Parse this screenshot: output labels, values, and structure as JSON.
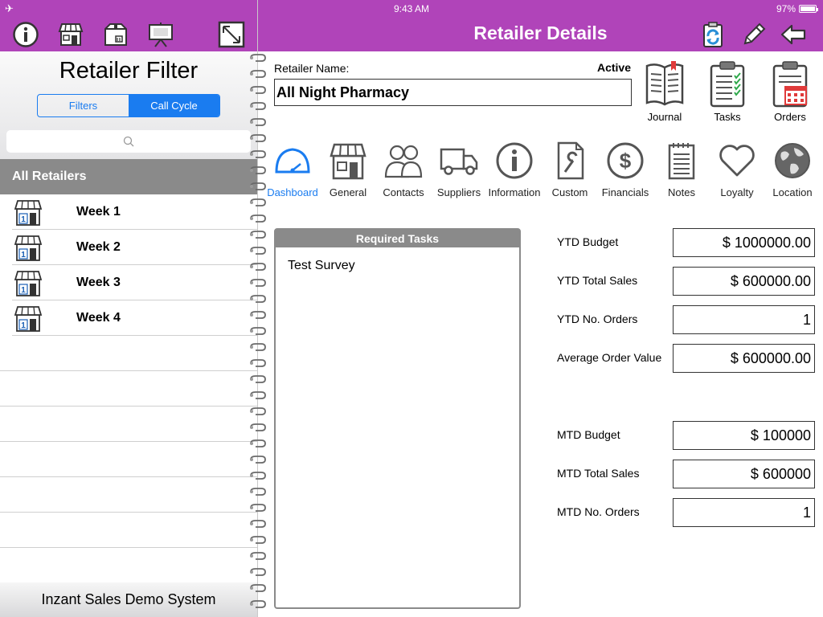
{
  "status": {
    "time": "9:43 AM",
    "battery": "97%",
    "airplane": "✈"
  },
  "toolbar_left": [
    {
      "icon": "info-icon"
    },
    {
      "icon": "store-icon"
    },
    {
      "icon": "package-icon"
    },
    {
      "icon": "presentation-icon"
    },
    {
      "icon": "resize-icon"
    }
  ],
  "header": {
    "title": "Retailer Details"
  },
  "toolbar_right": [
    {
      "icon": "sync-clipboard-icon"
    },
    {
      "icon": "pencil-icon"
    },
    {
      "icon": "back-arrow-icon"
    }
  ],
  "filter": {
    "title": "Retailer Filter",
    "segments": [
      "Filters",
      "Call Cycle"
    ],
    "selected": "Call Cycle",
    "search_placeholder": ""
  },
  "list": {
    "header": "All Retailers",
    "items": [
      "Week 1",
      "Week 2",
      "Week 3",
      "Week 4"
    ]
  },
  "footer": {
    "text": "Inzant Sales Demo System"
  },
  "retailer": {
    "name_label": "Retailer Name:",
    "status": "Active",
    "name": "All Night Pharmacy"
  },
  "quick_actions": [
    "Journal",
    "Tasks",
    "Orders"
  ],
  "nav": [
    "Dashboard",
    "General",
    "Contacts",
    "Suppliers",
    "Information",
    "Custom",
    "Financials",
    "Notes",
    "Loyalty",
    "Location"
  ],
  "required_tasks": {
    "title": "Required Tasks",
    "items": [
      "Test Survey"
    ]
  },
  "stats": [
    {
      "label": "YTD Budget",
      "value": "$ 1000000.00"
    },
    {
      "label": "YTD Total Sales",
      "value": "$ 600000.00"
    },
    {
      "label": "YTD No. Orders",
      "value": "1"
    },
    {
      "label": "Average Order Value",
      "value": "$ 600000.00"
    },
    {
      "label": "MTD Budget",
      "value": "$ 100000"
    },
    {
      "label": "MTD Total Sales",
      "value": "$ 600000"
    },
    {
      "label": "MTD No. Orders",
      "value": "1"
    }
  ],
  "colors": {
    "brand": "#b044b9",
    "accent": "#1a7cf0",
    "header_gray": "#8a8a8a"
  }
}
